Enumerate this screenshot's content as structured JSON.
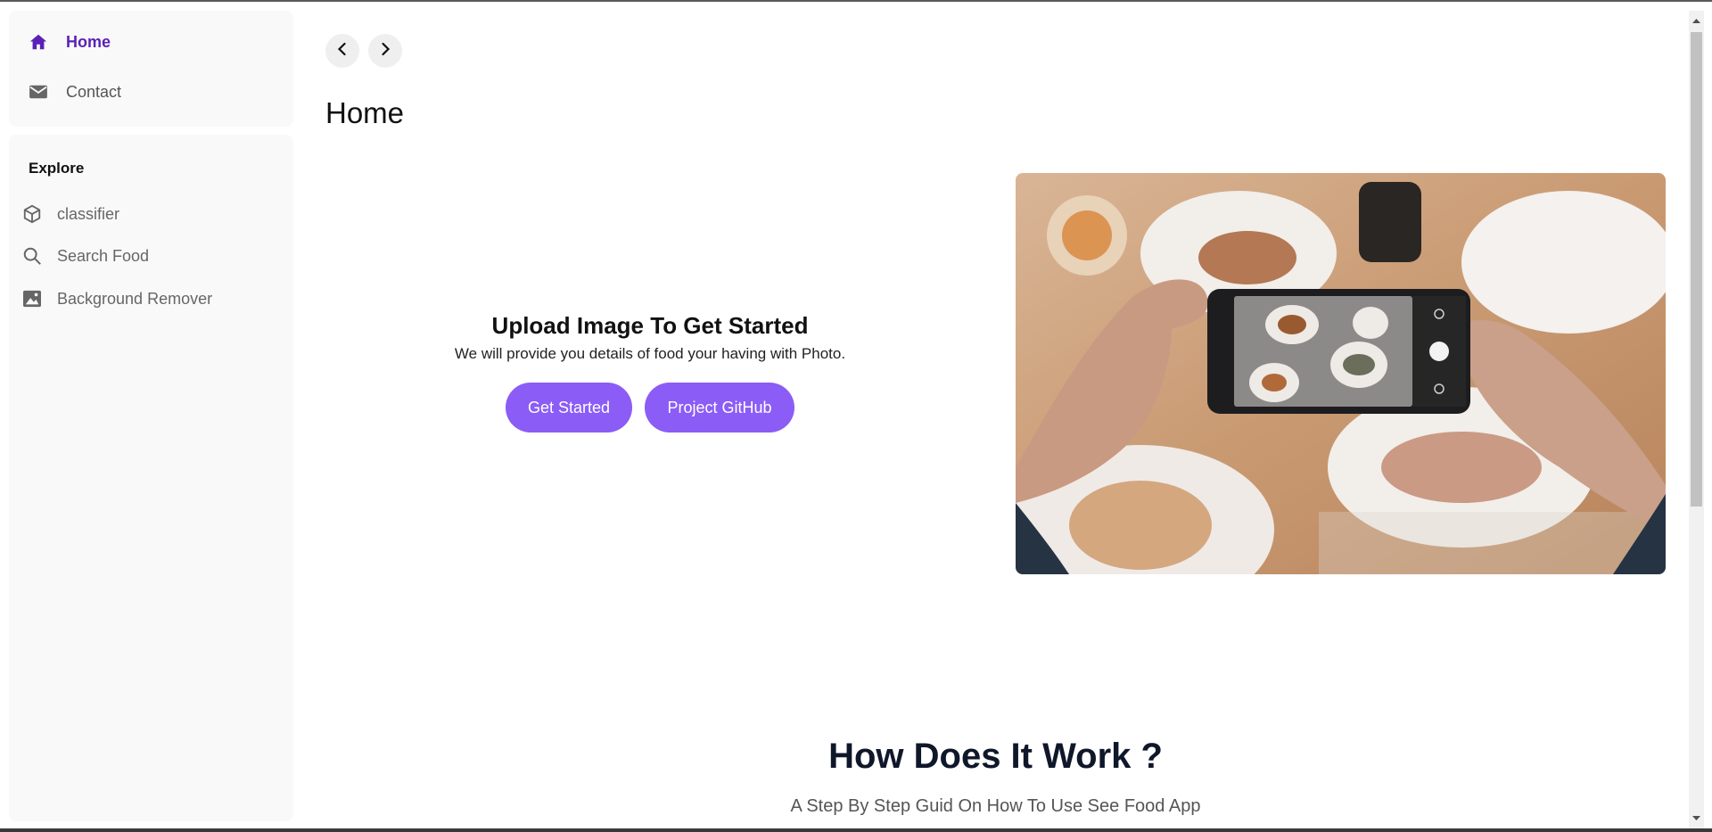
{
  "nav": {
    "items": [
      {
        "label": "Home",
        "icon": "home-icon",
        "active": true
      },
      {
        "label": "Contact",
        "icon": "envelope-icon",
        "active": false
      }
    ]
  },
  "explore": {
    "title": "Explore",
    "items": [
      {
        "label": "classifier",
        "icon": "cube-icon"
      },
      {
        "label": "Search Food",
        "icon": "search-icon"
      },
      {
        "label": "Background Remover",
        "icon": "image-icon"
      }
    ]
  },
  "main": {
    "back_icon": "chevron-left-icon",
    "forward_icon": "chevron-right-icon",
    "page_title": "Home",
    "hero": {
      "heading": "Upload Image To Get Started",
      "subtext": "We will provide you details of food your having with Photo.",
      "buttons": {
        "get_started": "Get Started",
        "github": "Project GitHub"
      }
    },
    "how": {
      "title": "How Does It Work ?",
      "subtitle": "A Step By Step Guid On How To Use See Food App"
    }
  },
  "colors": {
    "accent": "#8b5cf6",
    "active_nav": "#5b21b6",
    "sidebar_bg": "#f9f9f9"
  }
}
